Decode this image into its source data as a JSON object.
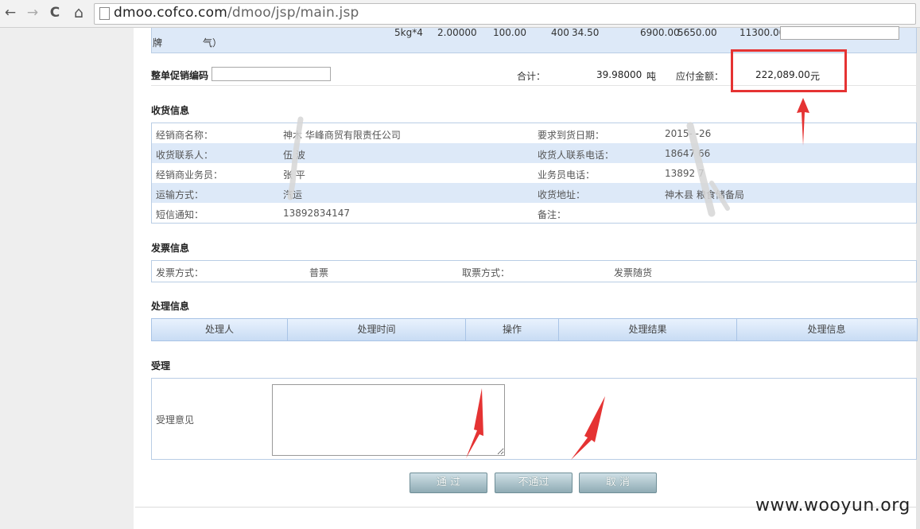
{
  "browser": {
    "back_icon": "←",
    "forward_icon": "→",
    "reload_icon": "C",
    "home_icon": "⌂",
    "url_host": "dmoo.cofco.com",
    "url_path": "/dmoo/jsp/main.jsp"
  },
  "product_row": {
    "brand_prefix": "牌",
    "brand_suffix": "气）",
    "spec": "5kg*4",
    "qty": "2.00000",
    "price1": "100.00",
    "price2": "400",
    "price3": "34.50",
    "amount1": "6900.00",
    "amount2": "5650.00",
    "amount3": "11300.00"
  },
  "summary": {
    "promo_label": "整单促销编码",
    "total_label": "合计：",
    "total_value": "39.98000",
    "total_unit": "吨",
    "payable_label": "应付金额：",
    "payable_value": "222,089.00",
    "payable_unit": "元"
  },
  "receipt": {
    "title": "收货信息",
    "rows": [
      {
        "l1": "经销商名称：",
        "v1": "神木   华峰商贸有限责任公司",
        "l2": "要求到货日期：",
        "v2": "2015-   -26"
      },
      {
        "l1": "收货联系人：",
        "v1": "伍   波",
        "l2": "收货人联系电话：",
        "v2": "18647    66"
      },
      {
        "l1": "经销商业务员：",
        "v1": "张   平",
        "l2": "业务员电话：",
        "v2": "13892    7"
      },
      {
        "l1": "运输方式：",
        "v1": "汽运",
        "l2": "收货地址：",
        "v2": "神木县   粮食储备局"
      },
      {
        "l1": "短信通知：",
        "v1": "13892834147",
        "l2": "备注：",
        "v2": ""
      }
    ]
  },
  "invoice": {
    "title": "发票信息",
    "method_label": "发票方式：",
    "method_value": "普票",
    "pickup_label": "取票方式：",
    "pickup_value": "发票随货"
  },
  "processing": {
    "title": "处理信息",
    "columns": [
      "处理人",
      "处理时间",
      "操作",
      "处理结果",
      "处理信息"
    ]
  },
  "accept": {
    "title": "受理",
    "opinion_label": "受理意见"
  },
  "buttons": {
    "pass": "通 过",
    "reject": "不通过",
    "cancel": "取 消"
  },
  "watermark": "www.wooyun.org",
  "colors": {
    "annotation_red": "#e53333",
    "row_blue": "#dde9f8",
    "border_blue": "#b9cde5"
  }
}
